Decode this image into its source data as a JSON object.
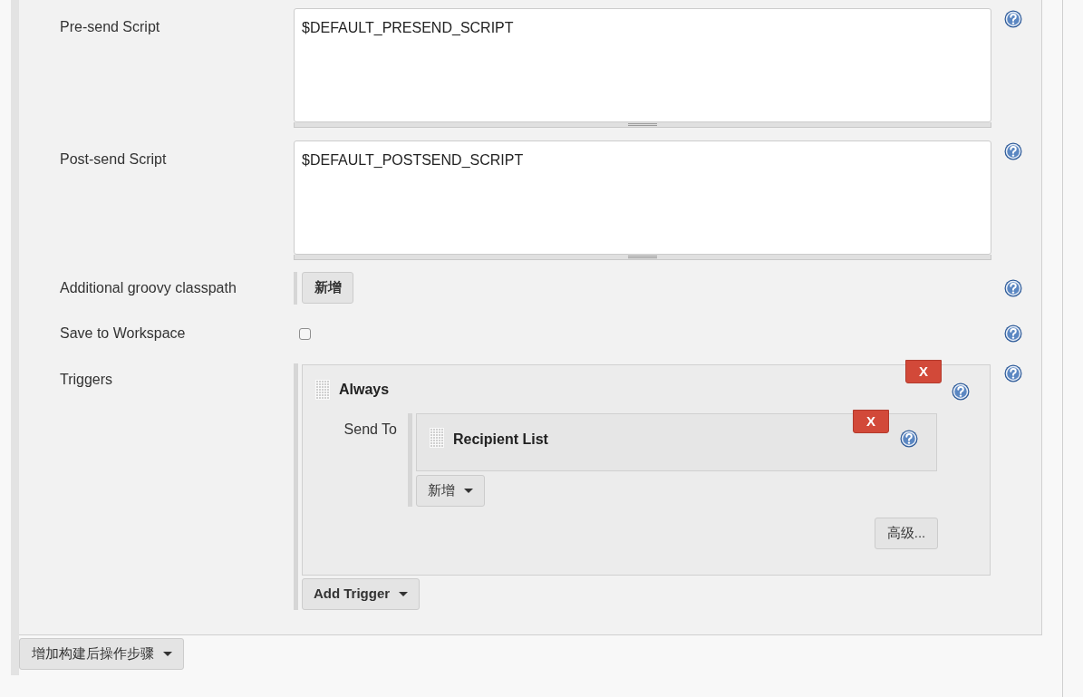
{
  "fields": [
    {
      "kind": "textarea",
      "label": "Pre-send Script",
      "value": "$DEFAULT_PRESEND_SCRIPT"
    },
    {
      "kind": "textarea",
      "label": "Post-send Script",
      "value": "$DEFAULT_POSTSEND_SCRIPT"
    },
    {
      "kind": "button",
      "label": "Additional groovy classpath",
      "button": "新增"
    },
    {
      "kind": "checkbox",
      "label": "Save to Workspace",
      "checked": false
    },
    {
      "kind": "triggers",
      "label": "Triggers",
      "triggers": [
        {
          "title": "Always",
          "delete": "X",
          "send_to": {
            "label": "Send To",
            "items": [
              {
                "title": "Recipient List",
                "delete": "X"
              }
            ],
            "add": "新增"
          },
          "advanced": "高级..."
        }
      ],
      "add": "Add Trigger"
    }
  ],
  "add_step": "增加构建后操作步骤"
}
